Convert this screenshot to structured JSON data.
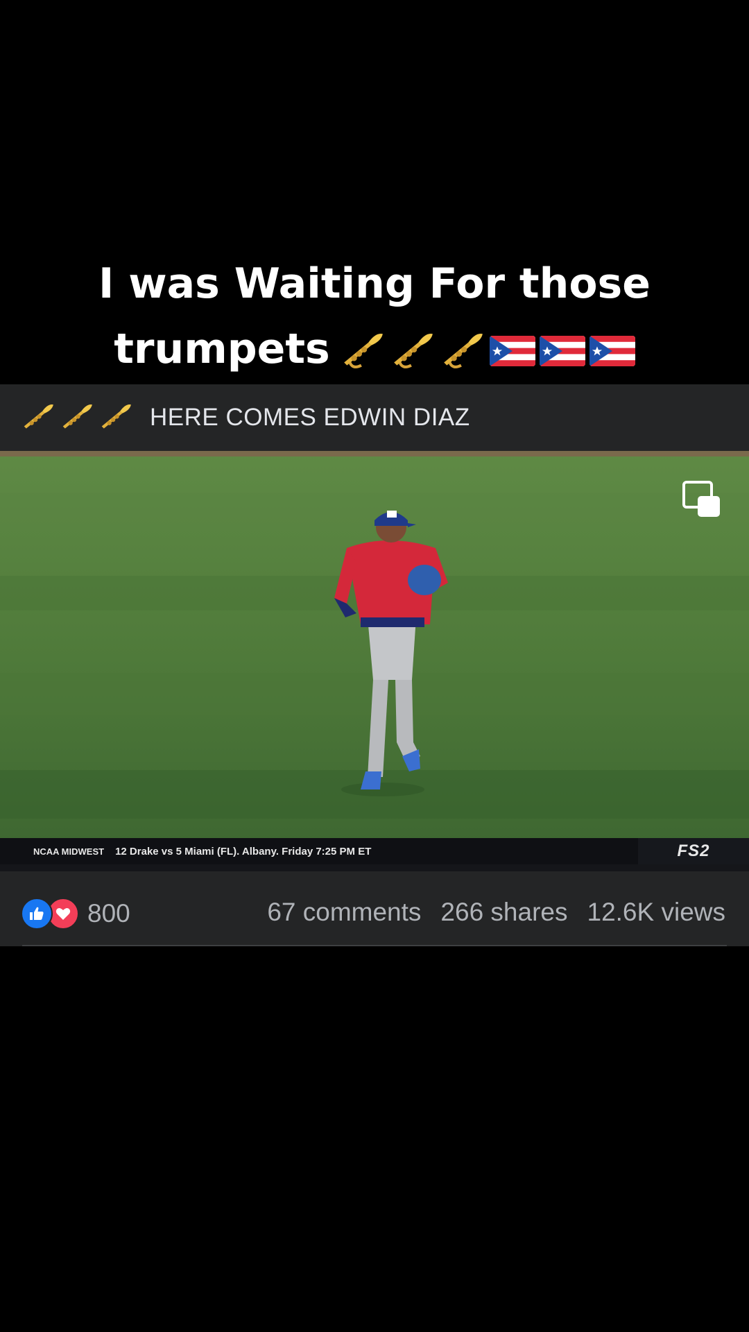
{
  "caption": {
    "line1": "I was Waiting For those",
    "line2": "trumpets",
    "emojis": [
      "trumpet-emoji",
      "trumpet-emoji",
      "trumpet-emoji",
      "puerto-rico-flag",
      "puerto-rico-flag",
      "puerto-rico-flag"
    ]
  },
  "post": {
    "header_text": "HERE COMES EDWIN DIAZ",
    "header_emojis": [
      "trumpet-emoji",
      "trumpet-emoji",
      "trumpet-emoji"
    ]
  },
  "video": {
    "ticker_label": "NCAA MIDWEST",
    "ticker_info": "12 Drake vs 5 Miami (FL). Albany. Friday 7:25 PM ET",
    "network": "FS2",
    "pip_icon": "picture-in-picture-icon",
    "colors": {
      "field": "#3f6a32",
      "jersey": "#d4283a",
      "cap": "#1f3a8a"
    }
  },
  "stats": {
    "reaction_icons": [
      "like-icon",
      "love-icon"
    ],
    "reaction_count": "800",
    "comments": "67 comments",
    "shares": "266 shares",
    "views": "12.6K views"
  }
}
